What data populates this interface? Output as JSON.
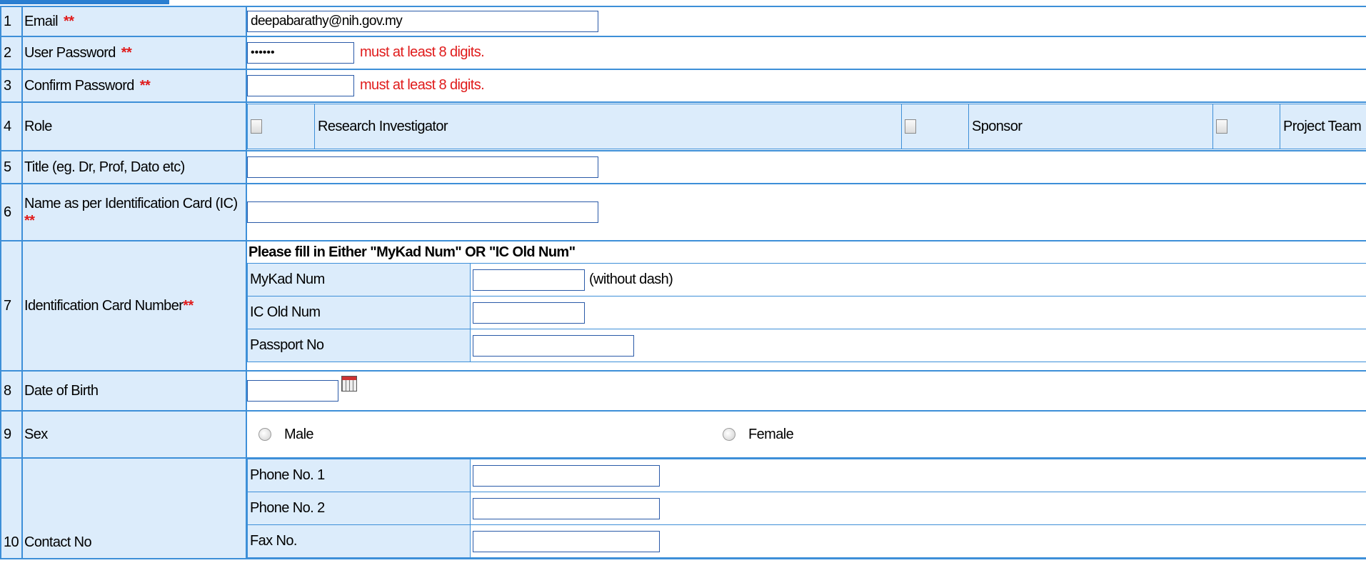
{
  "form": {
    "rows": {
      "email": {
        "num": "1",
        "label": "Email",
        "req": "**",
        "value": "deepabarathy@nih.gov.my"
      },
      "password": {
        "num": "2",
        "label": "User Password",
        "req": "**",
        "value": "••••••",
        "hint": "must at least 8 digits."
      },
      "confirm": {
        "num": "3",
        "label": "Confirm Password",
        "req": "**",
        "value": "",
        "hint": "must at least 8 digits."
      },
      "role": {
        "num": "4",
        "label": "Role",
        "options": [
          "Research Investigator",
          "Sponsor",
          "Project Team"
        ]
      },
      "title": {
        "num": "5",
        "label": "Title (eg. Dr, Prof, Dato etc)",
        "value": ""
      },
      "name": {
        "num": "6",
        "label": "Name as per Identification Card (IC)",
        "req": "**",
        "value": ""
      },
      "ic": {
        "num": "7",
        "label": "Identification Card Number",
        "req": "**",
        "instruction": "Please fill in Either \"MyKad Num\" OR \"IC Old Num\"",
        "mykad_label": "MyKad Num",
        "mykad_note": "(without dash)",
        "icold_label": "IC Old Num",
        "passport_label": "Passport No"
      },
      "dob": {
        "num": "8",
        "label": "Date of Birth",
        "value": ""
      },
      "sex": {
        "num": "9",
        "label": "Sex",
        "options": [
          "Male",
          "Female"
        ]
      },
      "contact": {
        "num": "10",
        "label": "Contact No",
        "phone1_label": "Phone No. 1",
        "phone2_label": "Phone No. 2",
        "fax_label": "Fax No."
      }
    }
  },
  "colors": {
    "border": "#3d8fd8",
    "label_bg": "#dcecfb",
    "required": "#e01b1b"
  }
}
